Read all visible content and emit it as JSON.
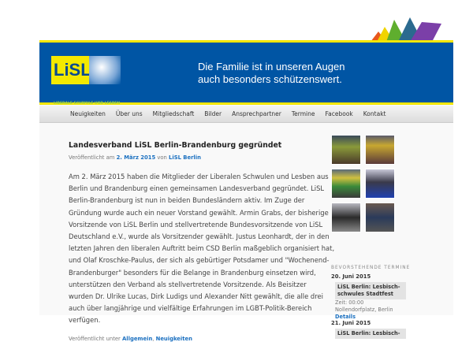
{
  "header": {
    "logo_text": "LiSL",
    "logo_subtitle": "LIBERALE SCHWULE UND LESBEN",
    "slogan": [
      "Die Familie ist in unseren Augen",
      "auch besonders schützenswert."
    ]
  },
  "nav": [
    "Neuigkeiten",
    "Über uns",
    "Mitgliedschaft",
    "Bilder",
    "Ansprechpartner",
    "Termine",
    "Facebook",
    "Kontakt"
  ],
  "post": {
    "title": "Landesverband LiSL Berlin-Brandenburg gegründet",
    "meta_prefix": "Veröffentlicht am",
    "date": "2. März 2015",
    "by": "von",
    "author": "LiSL Berlin",
    "lines": [
      "Am 2. März 2015 haben die Mitglieder der Liberalen Schwulen und Lesben aus",
      "Berlin und Brandenburg einen gemeinsamen Landesverband gegründet. LiSL",
      "Berlin-Brandenburg ist nun in beiden Bundesländern aktiv. Im Zuge der",
      "Gründung wurde auch ein neuer Vorstand gewählt. Armin Grabs, der bisherige",
      "Vorsitzende von LiSL Berlin und stellvertretende Bundesvorsitzende von LiSL",
      "Deutschland e.V., wurde als Vorsitzender gewählt. Justus Leonhardt, der in den",
      "letzten Jahren den liberalen Auftritt beim CSD Berlin maßgeblich organisiert hat,",
      "und Olaf Kroschke-Paulus, der sich als gebürtiger Potsdamer und \"Wochenend-",
      "Brandenburger\" besonders für die Belange in Brandenburg einsetzen wird,",
      "unterstützen den Verband als stellvertretende Vorsitzende. Als Beisitzer",
      "wurden Dr. Ulrike Lucas, Dirk Ludigs und Alexander Nitt gewählt, die alle drei",
      "auch über langjährige und vielfältige Erfahrungen im LGBT-Politik-Bereich",
      "verfügen."
    ],
    "footer_prefix": "Veröffentlicht unter",
    "cat1": "Allgemein",
    "cat2": "Neuigkeiten"
  },
  "sidebar": {
    "widget_title": "BEVORSTEHENDE TERMINE",
    "events": [
      {
        "date": "20. Juni 2015",
        "title": "LiSL Berlin: Lesbisch-schwules Stadtfest",
        "time": "Zeit: 00:00",
        "place": "Nollendorfplatz, Berlin",
        "details": "Details"
      },
      {
        "date": "21. Juni 2015",
        "title": "LiSL Berlin: Lesbisch-"
      }
    ]
  }
}
